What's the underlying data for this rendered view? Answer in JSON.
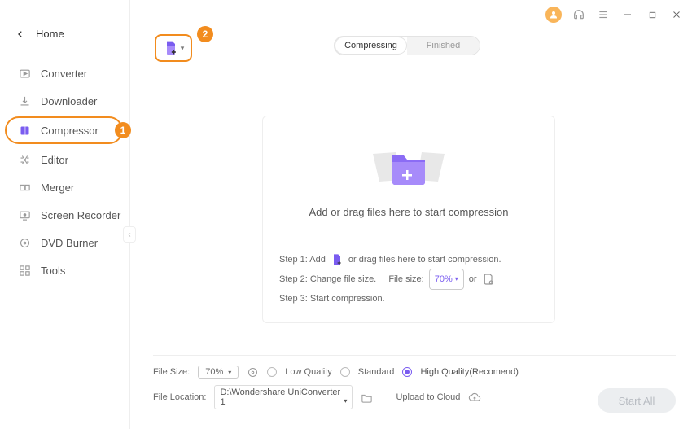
{
  "titlebar": {
    "avatar_initial": ""
  },
  "sidebar": {
    "home": "Home",
    "items": [
      {
        "label": "Converter"
      },
      {
        "label": "Downloader"
      },
      {
        "label": "Compressor"
      },
      {
        "label": "Editor"
      },
      {
        "label": "Merger"
      },
      {
        "label": "Screen Recorder"
      },
      {
        "label": "DVD Burner"
      },
      {
        "label": "Tools"
      }
    ]
  },
  "annotations": {
    "badge1": "1",
    "badge2": "2"
  },
  "tabs": {
    "compressing": "Compressing",
    "finished": "Finished"
  },
  "dropzone": {
    "text": "Add or drag files here to start compression"
  },
  "steps": {
    "s1_a": "Step 1: Add",
    "s1_b": "or drag files here to start compression.",
    "s2_a": "Step 2: Change file size.",
    "s2_filesize_label": "File size:",
    "s2_percent": "70%",
    "s2_or": "or",
    "s3": "Step 3: Start compression."
  },
  "bottom": {
    "filesize_label": "File Size:",
    "filesize_value": "70%",
    "quality_low": "Low Quality",
    "quality_standard": "Standard",
    "quality_high": "High Quality(Recomend)",
    "location_label": "File Location:",
    "location_value": "D:\\Wondershare UniConverter 1",
    "upload_label": "Upload to Cloud",
    "start_all": "Start All"
  }
}
